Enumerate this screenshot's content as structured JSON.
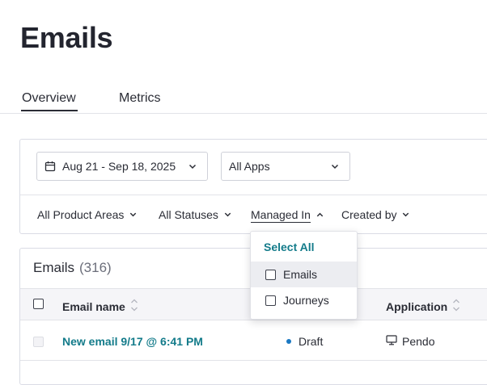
{
  "page": {
    "title": "Emails"
  },
  "tabs": [
    {
      "label": "Overview",
      "active": true
    },
    {
      "label": "Metrics",
      "active": false
    }
  ],
  "filters": {
    "date_range": "Aug 21 - Sep 18, 2025",
    "apps": "All Apps",
    "product_areas": "All Product Areas",
    "statuses": "All Statuses",
    "managed_in": "Managed In",
    "created_by": "Created by"
  },
  "managed_in_dropdown": {
    "select_all": "Select All",
    "options": [
      {
        "label": "Emails",
        "checked": false,
        "hovered": true
      },
      {
        "label": "Journeys",
        "checked": false,
        "hovered": false
      }
    ]
  },
  "table": {
    "title": "Emails",
    "count": "(316)",
    "columns": [
      "Email name",
      "Application"
    ],
    "rows": [
      {
        "name": "New email 9/17 @ 6:41 PM",
        "status": "Draft",
        "application": "Pendo"
      }
    ]
  },
  "colors": {
    "link": "#137b8a",
    "status_draft": "#1a78c2",
    "text": "#2a2c35"
  },
  "icons": [
    "calendar-icon",
    "chevron-down-icon",
    "chevron-up-icon",
    "sort-icon",
    "monitor-icon"
  ]
}
